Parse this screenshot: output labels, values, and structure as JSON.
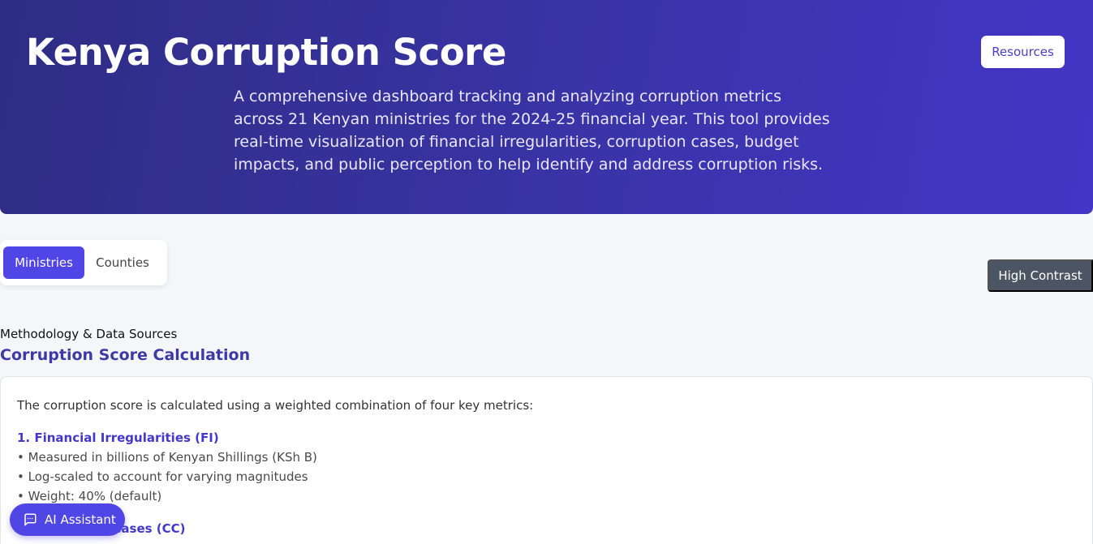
{
  "header": {
    "title": "Kenya Corruption Score",
    "description": "A comprehensive dashboard tracking and analyzing corruption metrics across 21 Kenyan ministries for the 2024-25 financial year. This tool provides real-time visualization of financial irregularities, corruption cases, budget impacts, and public perception to help identify and address corruption risks.",
    "resources_label": "Resources"
  },
  "tabs": [
    {
      "label": "Ministries",
      "active": true
    },
    {
      "label": "Counties",
      "active": false
    }
  ],
  "high_contrast_label": "High Contrast",
  "methodology": {
    "label": "Methodology & Data Sources",
    "heading": "Corruption Score Calculation",
    "intro": "The corruption score is calculated using a weighted combination of four key metrics:",
    "metrics": [
      {
        "title": "1. Financial Irregularities (FI)",
        "bullets": [
          "• Measured in billions of Kenyan Shillings (KSh B)",
          "• Log-scaled to account for varying magnitudes",
          "• Weight: 40% (default)"
        ]
      },
      {
        "title": "2. Corruption Cases (CC)"
      }
    ]
  },
  "ai_assistant": {
    "label": "AI Assistant",
    "icon": "chat-icon"
  },
  "colors": {
    "accent": "#4f46e5",
    "hero_start": "#2e2d83",
    "hero_end": "#4335c6",
    "contrast_button": "#4b5563"
  }
}
